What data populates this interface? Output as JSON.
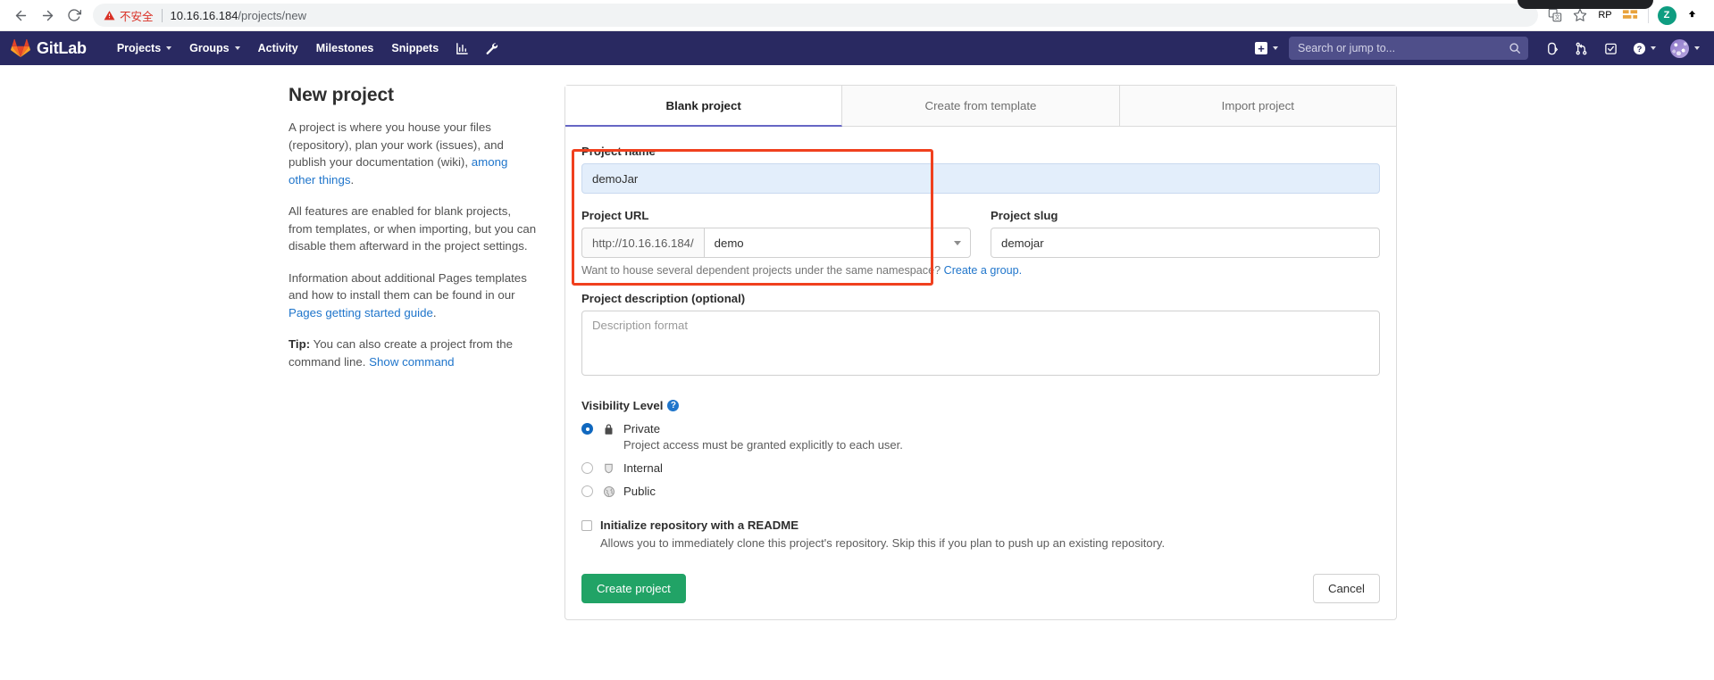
{
  "browser": {
    "back_icon": "back-arrow-icon",
    "forward_icon": "forward-arrow-icon",
    "reload_icon": "reload-icon",
    "security_warning": "不安全",
    "url_host": "10.16.16.184",
    "url_path": "/projects/new",
    "extensions": [
      {
        "name": "translate-extension-icon",
        "label": ""
      },
      {
        "name": "bookmark-star-icon",
        "label": ""
      },
      {
        "name": "rp-extension-icon",
        "label": "RP"
      },
      {
        "name": "grid-extension-icon",
        "label": ""
      },
      {
        "name": "profile-avatar-icon",
        "label": "Z"
      },
      {
        "name": "updater-extension-icon",
        "label": ""
      }
    ]
  },
  "navbar": {
    "brand": "GitLab",
    "items": [
      {
        "label": "Projects",
        "caret": true
      },
      {
        "label": "Groups",
        "caret": true
      },
      {
        "label": "Activity",
        "caret": false
      },
      {
        "label": "Milestones",
        "caret": false
      },
      {
        "label": "Snippets",
        "caret": false
      }
    ],
    "icons": [
      {
        "name": "analytics-chart-icon"
      },
      {
        "name": "admin-wrench-icon"
      }
    ],
    "search_placeholder": "Search or jump to...",
    "right_icons": [
      {
        "name": "issues-icon"
      },
      {
        "name": "merge-requests-icon"
      },
      {
        "name": "todos-icon"
      }
    ],
    "brand_color": "#292961"
  },
  "sidebar": {
    "title": "New project",
    "para1_a": "A project is where you house your files (repository), plan your work (issues), and publish your documentation (wiki), ",
    "para1_link": "among other things",
    "para1_b": ".",
    "para2": "All features are enabled for blank projects, from templates, or when importing, but you can disable them afterward in the project settings.",
    "para3_a": "Information about additional Pages templates and how to install them can be found in our ",
    "para3_link": "Pages getting started guide",
    "para3_b": ".",
    "tip_bold": "Tip:",
    "tip_text": " You can also create a project from the command line. ",
    "tip_link": "Show command"
  },
  "tabs": [
    {
      "label": "Blank project",
      "active": true
    },
    {
      "label": "Create from template",
      "active": false
    },
    {
      "label": "Import project",
      "active": false
    }
  ],
  "form": {
    "project_name_label": "Project name",
    "project_name_value": "demoJar",
    "project_url_label": "Project URL",
    "project_url_prefix": "http://10.16.16.184/",
    "project_url_namespace": "demo",
    "project_slug_label": "Project slug",
    "project_slug_value": "demojar",
    "namespace_help_text": "Want to house several dependent projects under the same namespace? ",
    "namespace_help_link": "Create a group.",
    "description_label": "Project description (optional)",
    "description_placeholder": "Description format",
    "visibility_label": "Visibility Level",
    "visibility_help_icon": "question-mark-icon",
    "visibility_options": [
      {
        "name": "Private",
        "icon": "lock-icon",
        "selected": true,
        "description": "Project access must be granted explicitly to each user."
      },
      {
        "name": "Internal",
        "icon": "shield-icon",
        "selected": false,
        "description": ""
      },
      {
        "name": "Public",
        "icon": "globe-icon",
        "selected": false,
        "description": ""
      }
    ],
    "readme_label": "Initialize repository with a README",
    "readme_checked": false,
    "readme_description": "Allows you to immediately clone this project's repository. Skip this if you plan to push up an existing repository.",
    "submit_label": "Create project",
    "cancel_label": "Cancel"
  },
  "annotation": {
    "color": "#f0401e",
    "label": "highlight-box-project-name-url"
  }
}
